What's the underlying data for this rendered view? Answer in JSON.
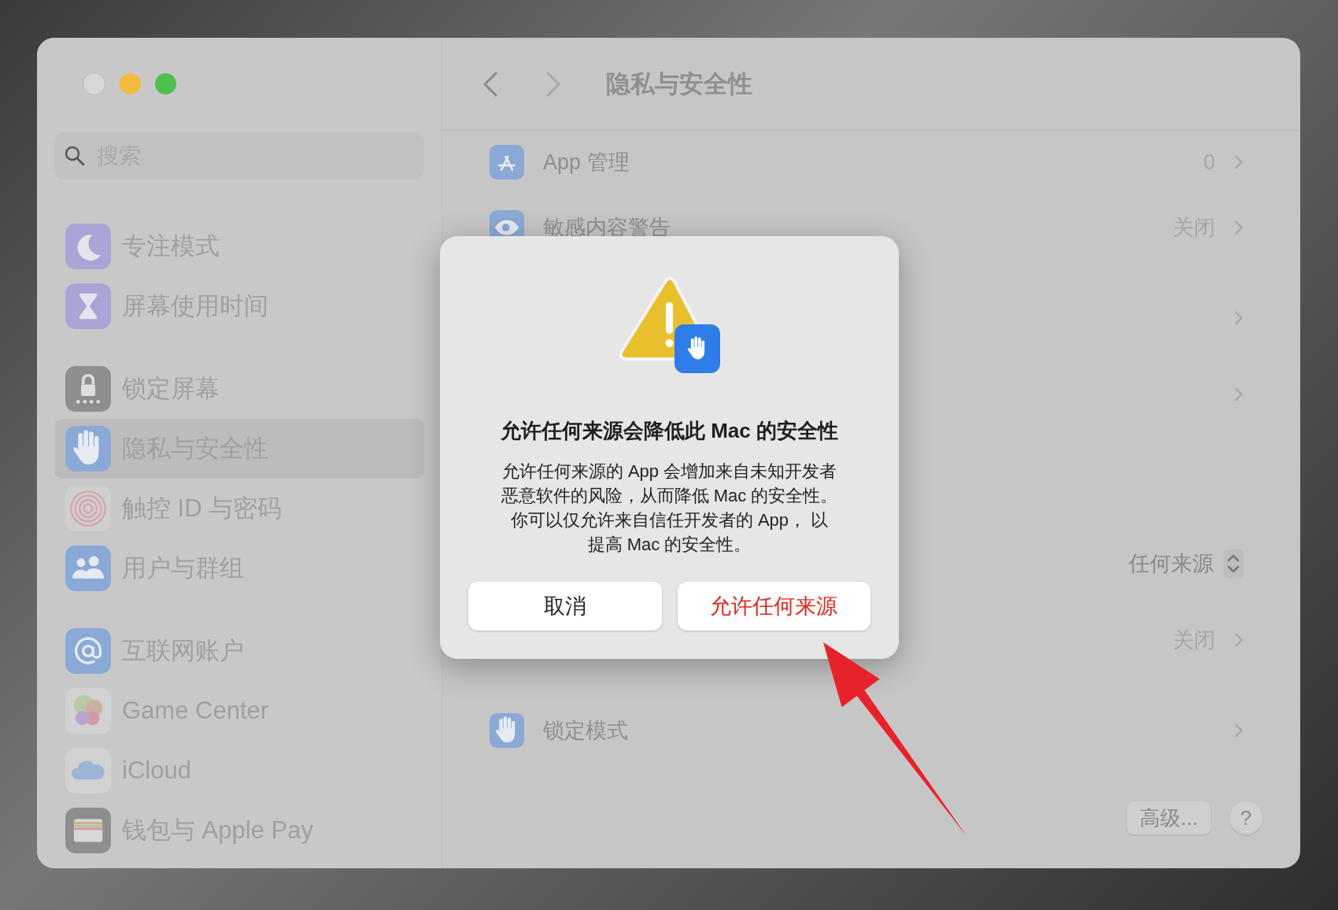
{
  "sidebar": {
    "search": {
      "placeholder": "搜索"
    },
    "groups": [
      [
        {
          "label": "专注模式",
          "kind": "focus",
          "selected": false
        },
        {
          "label": "屏幕使用时间",
          "kind": "screentime",
          "selected": false
        }
      ],
      [
        {
          "label": "锁定屏幕",
          "kind": "lockscreen",
          "selected": false
        },
        {
          "label": "隐私与安全性",
          "kind": "privacy",
          "selected": true
        },
        {
          "label": "触控 ID 与密码",
          "kind": "touchid",
          "selected": false
        },
        {
          "label": "用户与群组",
          "kind": "users",
          "selected": false
        }
      ],
      [
        {
          "label": "互联网账户",
          "kind": "internet",
          "selected": false
        },
        {
          "label": "Game Center",
          "kind": "gamecenter",
          "selected": false
        },
        {
          "label": "iCloud",
          "kind": "icloud",
          "selected": false
        },
        {
          "label": "钱包与 Apple Pay",
          "kind": "wallet",
          "selected": false
        }
      ]
    ]
  },
  "header": {
    "title": "隐私与安全性"
  },
  "groups": [
    [
      {
        "kind": "appstore",
        "label": "App 管理",
        "value": "0"
      }
    ],
    [
      {
        "kind": "eye",
        "label": "敏感内容警告",
        "value": "关闭"
      }
    ],
    [
      {
        "kind": "plain"
      },
      {
        "kind": "plain"
      }
    ],
    [
      {
        "kind": "popup",
        "value": "任何来源"
      },
      {
        "kind": "plain",
        "value": "关闭"
      }
    ],
    [
      {
        "kind": "hand",
        "label": "锁定模式"
      }
    ]
  ],
  "footer": {
    "advanced": "高级...",
    "help": "?"
  },
  "dialog": {
    "title": "允许任何来源会降低此 Mac 的安全性",
    "message": [
      "允许任何来源的 App 会增加来自未知开发者",
      "恶意软件的风险，从而降低 Mac 的安全性。",
      "你可以仅允许来自信任开发者的 App， 以",
      "提高 Mac 的安全性。"
    ],
    "buttons": [
      {
        "label": "取消",
        "kind": "cancel"
      },
      {
        "label": "允许任何来源",
        "kind": "destructive"
      }
    ]
  }
}
